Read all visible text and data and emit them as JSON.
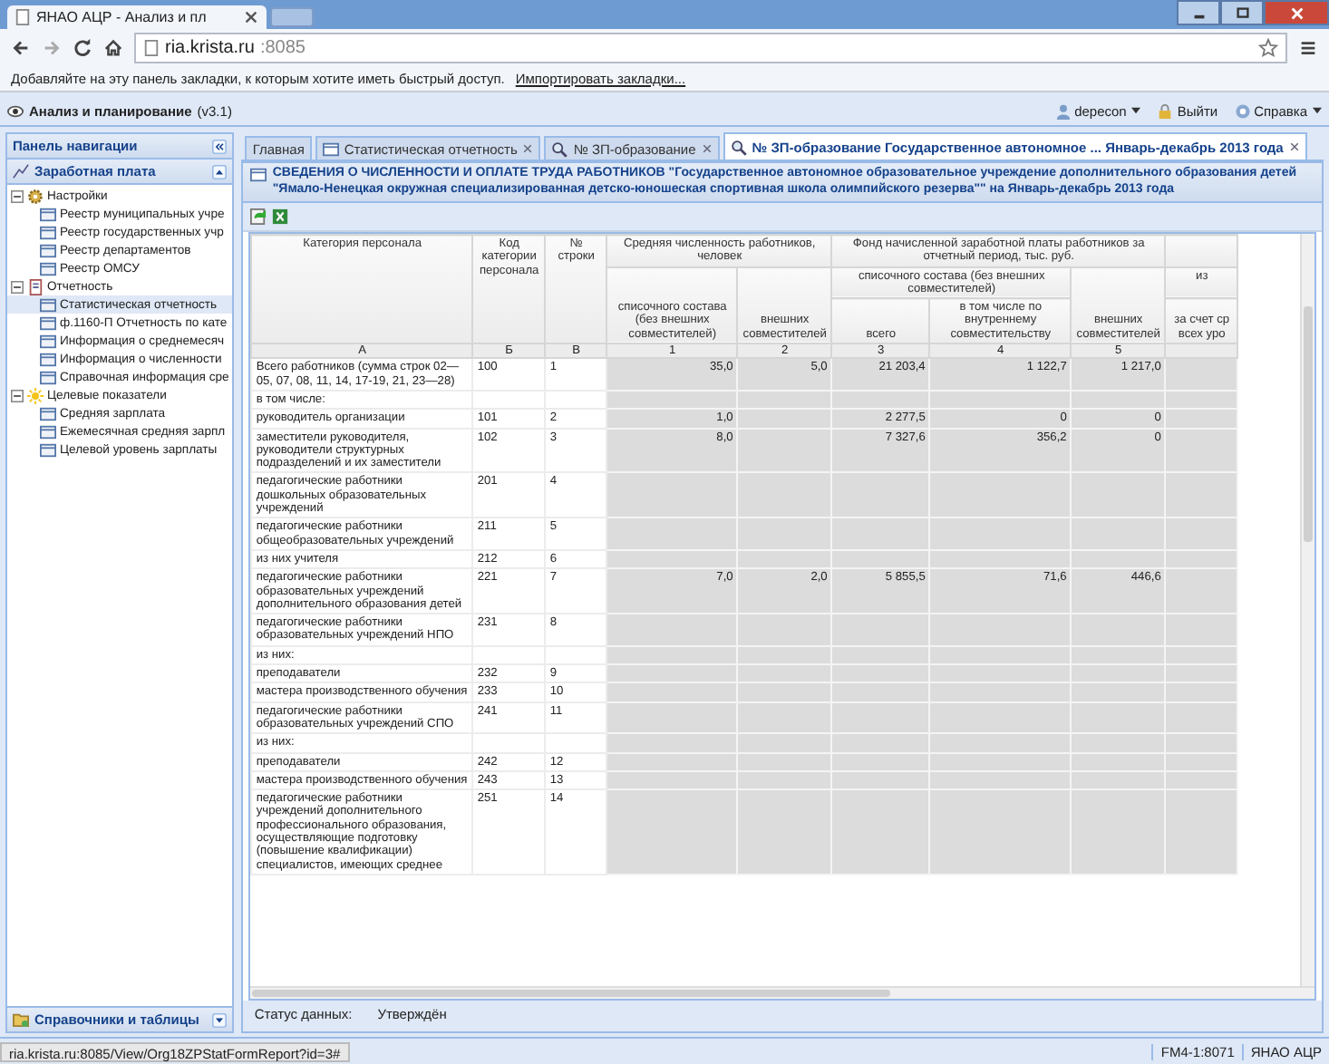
{
  "browser": {
    "tab_title": "ЯНАО АЦР - Анализ и пл",
    "address_host": "ria.krista.ru",
    "address_port": ":8085",
    "bookmarks_hint": "Добавляйте на эту панель закладки, к которым хотите иметь быстрый доступ.",
    "bookmarks_link": "Импортировать закладки...",
    "status_url": "ria.krista.ru:8085/View/Org18ZPStatFormReport?id=3#"
  },
  "app": {
    "title": "Анализ и планирование",
    "version": "(v3.1)",
    "user": "depecon",
    "logout": "Выйти",
    "help": "Справка"
  },
  "nav": {
    "title": "Панель навигации",
    "section": "Заработная плата",
    "footer_section": "Справочники и таблицы",
    "tree": [
      {
        "label": "Настройки",
        "kind": "settings",
        "expanded": true,
        "children": [
          {
            "label": "Реестр муниципальных учре",
            "selected": false
          },
          {
            "label": "Реестр государственных учр",
            "selected": false
          },
          {
            "label": "Реестр департаментов",
            "selected": false
          },
          {
            "label": "Реестр ОМСУ",
            "selected": false
          }
        ]
      },
      {
        "label": "Отчетность",
        "kind": "report",
        "expanded": true,
        "children": [
          {
            "label": "Статистическая отчетность",
            "selected": true
          },
          {
            "label": "ф.1160-П Отчетность по кате",
            "selected": false
          },
          {
            "label": "Информация о среднемесяч",
            "selected": false
          },
          {
            "label": "Информация о численности",
            "selected": false
          },
          {
            "label": "Справочная информация сре",
            "selected": false
          }
        ]
      },
      {
        "label": "Целевые показатели",
        "kind": "target",
        "expanded": true,
        "children": [
          {
            "label": "Средняя зарплата",
            "selected": false
          },
          {
            "label": "Ежемесячная средняя зарпл",
            "selected": false
          },
          {
            "label": "Целевой уровень зарплаты",
            "selected": false
          }
        ]
      }
    ]
  },
  "tabs": [
    {
      "label": "Главная",
      "kind": "plain",
      "closable": false,
      "selected": false
    },
    {
      "label": "Статистическая отчетность",
      "kind": "list",
      "closable": true,
      "selected": false
    },
    {
      "label": "№ ЗП-образование",
      "kind": "search",
      "closable": true,
      "selected": false
    },
    {
      "label": "№ ЗП-образование Государственное автономное ... Январь-декабрь 2013 года",
      "kind": "search",
      "closable": true,
      "selected": true
    }
  ],
  "form": {
    "title_bold": "СВЕДЕНИЯ О ЧИСЛЕННОСТИ И ОПЛАТЕ ТРУДА РАБОТНИКОВ",
    "title_rest": "\"Государственное автономное образовательное учреждение дополнительного образования детей \"Ямало-Ненецкая окружная специализированная детско-юношеская спортивная школа олимпийского резерва\"\" на Январь-декабрь 2013 года",
    "status_label": "Статус данных:",
    "status_value": "Утверждён"
  },
  "table": {
    "fixed_columns": [
      "Категория персонала",
      "Код категории персонала",
      "№ строки"
    ],
    "groups": [
      {
        "label": "Средняя численность работников, человек",
        "children": [
          {
            "label": "списочного состава (без внешних совместителей)"
          },
          {
            "label": "внешних совместителей"
          }
        ]
      },
      {
        "label": "Фонд начисленной заработной платы работников за отчетный период, тыс. руб.",
        "children": [
          {
            "label": "списочного состава (без внешних совместителей)",
            "children": [
              {
                "label": "всего"
              },
              {
                "label": "в том числе по внутреннему совместительству"
              }
            ]
          },
          {
            "label": "внешних совместителей"
          }
        ]
      },
      {
        "children": [
          {
            "label": "из",
            "children": [
              {
                "label": "за счет ср всех уро"
              }
            ]
          }
        ]
      }
    ],
    "column_letters": [
      "А",
      "Б",
      "В",
      "1",
      "2",
      "3",
      "4",
      "5"
    ],
    "rows": [
      {
        "category": "Всего работников (сумма строк 02—05, 07, 08, 11, 14, 17-19, 21, 23—28)",
        "code": "100",
        "line": "1",
        "values": {
          "1": "35,0",
          "2": "5,0",
          "3": "21 203,4",
          "4": "1 122,7",
          "5": "1 217,0"
        }
      },
      {
        "category": "в том числе:"
      },
      {
        "category": "руководитель организации",
        "code": "101",
        "line": "2",
        "values": {
          "1": "1,0",
          "3": "2 277,5",
          "4": "0",
          "5": "0"
        }
      },
      {
        "category": "заместители руководителя, руководители структурных подразделений и их заместители",
        "code": "102",
        "line": "3",
        "values": {
          "1": "8,0",
          "3": "7 327,6",
          "4": "356,2",
          "5": "0"
        }
      },
      {
        "category": "педагогические работники дошкольных образовательных учреждений",
        "code": "201",
        "line": "4"
      },
      {
        "category": "педагогические работники общеобразовательных учреждений",
        "code": "211",
        "line": "5"
      },
      {
        "category": "из них учителя",
        "code": "212",
        "line": "6"
      },
      {
        "category": "педагогические работники образовательных учреждений дополнительного образования детей",
        "code": "221",
        "line": "7",
        "values": {
          "1": "7,0",
          "2": "2,0",
          "3": "5 855,5",
          "4": "71,6",
          "5": "446,6"
        }
      },
      {
        "category": "педагогические работники образовательных учреждений НПО",
        "code": "231",
        "line": "8"
      },
      {
        "category": "из них:"
      },
      {
        "category": "преподаватели",
        "code": "232",
        "line": "9"
      },
      {
        "category": "мастера производственного обучения",
        "code": "233",
        "line": "10"
      },
      {
        "category": "педагогические работники образовательных учреждений СПО",
        "code": "241",
        "line": "11"
      },
      {
        "category": "из них:"
      },
      {
        "category": "преподаватели",
        "code": "242",
        "line": "12"
      },
      {
        "category": "мастера производственного обучения",
        "code": "243",
        "line": "13"
      },
      {
        "category": "педагогические работники учреждений дополнительного профессионального образования, осуществляющие подготовку (повышение квалификации) специалистов, имеющих среднее",
        "code": "251",
        "line": "14"
      }
    ]
  },
  "status_bar": {
    "server": "FM4-1:8071",
    "org": "ЯНАО АЦР"
  }
}
